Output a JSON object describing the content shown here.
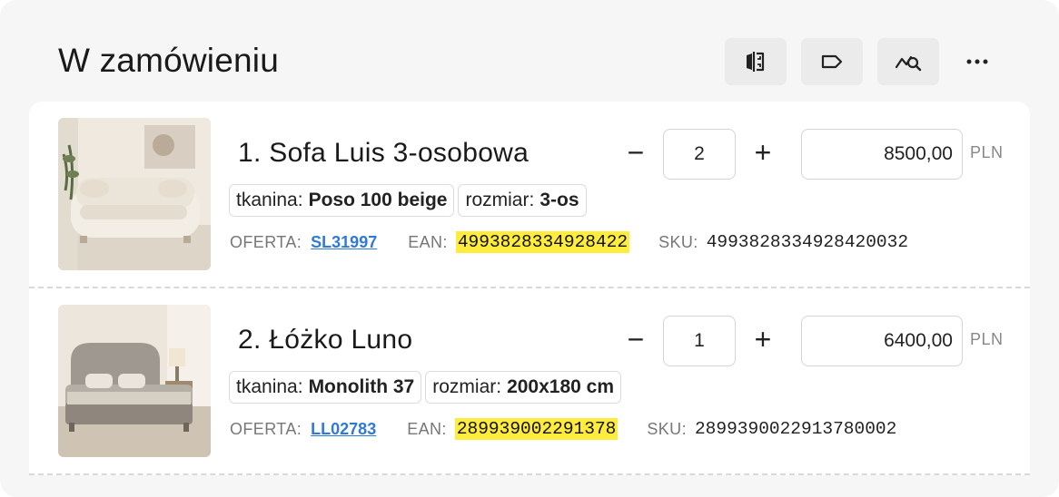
{
  "header": {
    "title": "W zamówieniu",
    "buttons": [
      {
        "icon": "split-compare-icon"
      },
      {
        "icon": "tag-icon"
      },
      {
        "icon": "chart-search-icon"
      },
      {
        "icon": "more-dots-icon"
      }
    ]
  },
  "labels": {
    "offer": "OFERTA:",
    "ean": "EAN:",
    "sku": "SKU:",
    "currency": "PLN",
    "minus": "−",
    "plus": "+"
  },
  "items": [
    {
      "name": "1. Sofa Luis 3-osobowa",
      "attributes": [
        {
          "label": "tkanina:",
          "value": "Poso 100 beige"
        },
        {
          "label": "rozmiar:",
          "value": "3-os"
        }
      ],
      "offer": "SL31997",
      "ean": "4993828334928422",
      "sku": "4993828334928420032",
      "quantity": "2",
      "price": "8500,00"
    },
    {
      "name": "2. Łóżko Luno",
      "attributes": [
        {
          "label": "tkanina:",
          "value": "Monolith 37"
        },
        {
          "label": "rozmiar:",
          "value": "200x180 cm"
        }
      ],
      "offer": "LL02783",
      "ean": "289939002291378",
      "sku": "2899390022913780002",
      "quantity": "1",
      "price": "6400,00"
    }
  ],
  "colors": {
    "accent_link": "#2f7ad6",
    "highlight": "#ffec3d"
  }
}
